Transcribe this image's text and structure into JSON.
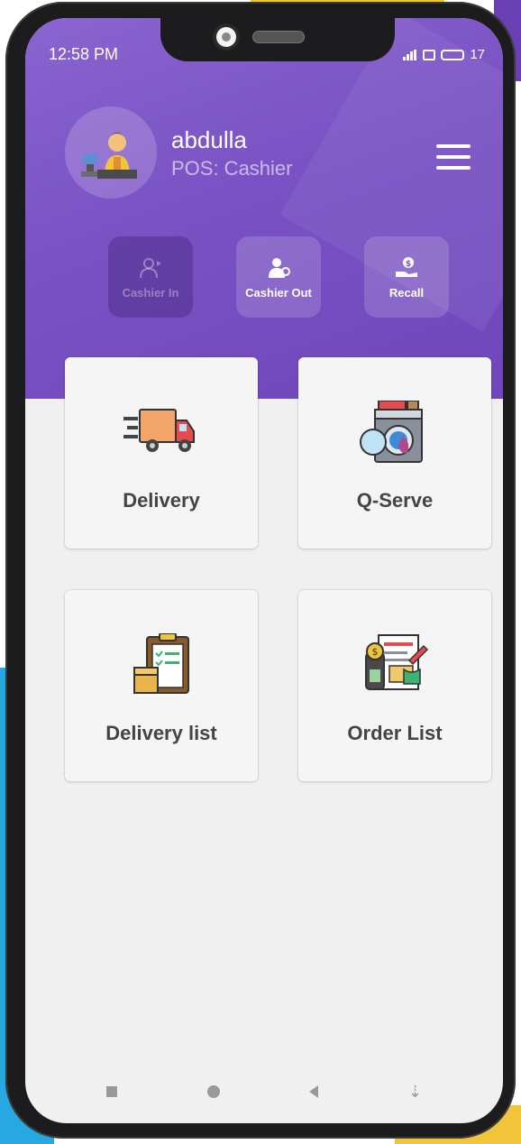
{
  "status": {
    "time": "12:58 PM",
    "battery": "17"
  },
  "user": {
    "name": "abdulla",
    "role": "POS: Cashier"
  },
  "quick_actions": [
    {
      "label": "Cashier In",
      "icon": "cashier-in-icon",
      "enabled": false
    },
    {
      "label": "Cashier Out",
      "icon": "cashier-out-icon",
      "enabled": true
    },
    {
      "label": "Recall",
      "icon": "recall-icon",
      "enabled": true
    }
  ],
  "tiles": [
    {
      "label": "Delivery",
      "icon": "delivery-truck-icon"
    },
    {
      "label": "Q-Serve",
      "icon": "washing-machine-icon"
    },
    {
      "label": "Delivery list",
      "icon": "clipboard-package-icon"
    },
    {
      "label": "Order List",
      "icon": "invoice-payment-icon"
    }
  ],
  "colors": {
    "header": "#7a52c4",
    "background": "#f0f0f0",
    "card": "#f5f5f5",
    "text": "#444444"
  }
}
